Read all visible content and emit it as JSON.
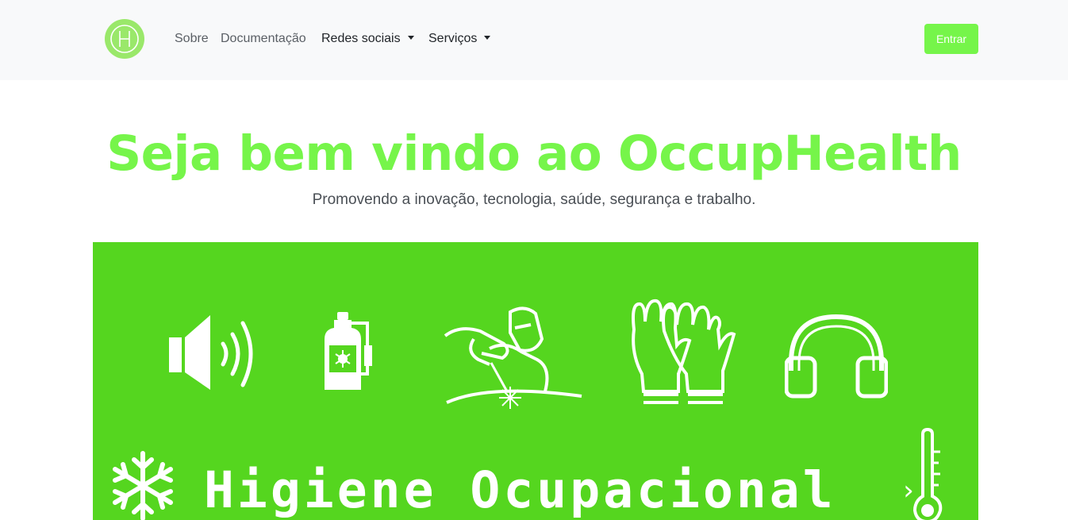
{
  "brand": {
    "logo_letter": "H",
    "accent": "#76f54a",
    "banner_green": "#55d61f"
  },
  "nav": {
    "items": [
      {
        "label": "Sobre",
        "dropdown": false
      },
      {
        "label": "Documentação",
        "dropdown": false
      },
      {
        "label": "Redes sociais",
        "dropdown": true
      },
      {
        "label": "Serviços",
        "dropdown": true
      }
    ],
    "login_label": "Entrar"
  },
  "hero": {
    "title": "Seja bem vindo ao OccupHealth",
    "subtitle": "Promovendo a inovação, tecnologia, saúde, segurança e trabalho."
  },
  "banner": {
    "title": "Higiene Ocupacional",
    "icons": [
      "speaker-icon",
      "pesticide-sprayer-icon",
      "welder-icon",
      "gloves-icon",
      "headphones-icon",
      "snowflake-icon",
      "thermometer-icon"
    ],
    "next_glyph": "›"
  }
}
